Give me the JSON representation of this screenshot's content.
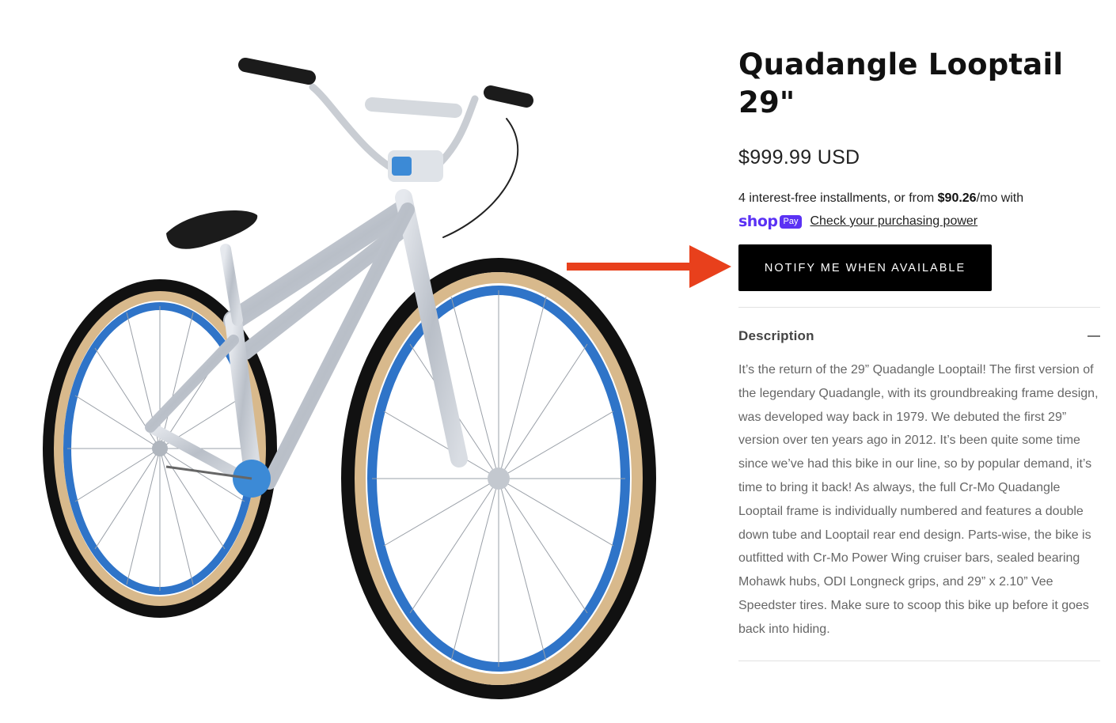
{
  "product": {
    "title": "Quadangle Looptail 29\"",
    "price": "$999.99 USD",
    "installments_prefix": "4 interest-free installments, or from ",
    "installments_amount": "$90.26",
    "installments_suffix": "/mo with",
    "shop_word": "shop",
    "pay_badge": "Pay",
    "purchasing_link": "Check your purchasing power",
    "notify_button": "NOTIFY ME WHEN AVAILABLE"
  },
  "description": {
    "title": "Description",
    "toggle_icon": "minus-icon",
    "body": "It’s the return of the 29” Quadangle Looptail! The first version of the legendary Quadangle, with its groundbreaking frame design, was developed way back in 1979. We debuted the first 29” version over ten years ago in 2012. It’s been quite some time since we’ve had this bike in our line, so by popular demand, it’s time to bring it back! As always, the full Cr-Mo Quadangle Looptail frame is individually numbered and features a double down tube and Looptail rear end design. Parts-wise, the bike is outfitted with Cr-Mo Power Wing cruiser bars, sealed bearing Mohawk hubs, ODI Longneck grips, and 29” x 2.10” Vee Speedster tires. Make sure to scoop this bike up before it goes back into hiding."
  },
  "image": {
    "subject": "bicycle-image"
  },
  "colors": {
    "button_bg": "#000000",
    "shop_purple": "#5a31f4",
    "arrow_red": "#e8401c",
    "rim_blue": "#2f74c8",
    "frame_silver": "#c7ccd3",
    "tire_tan": "#d8b98c"
  }
}
